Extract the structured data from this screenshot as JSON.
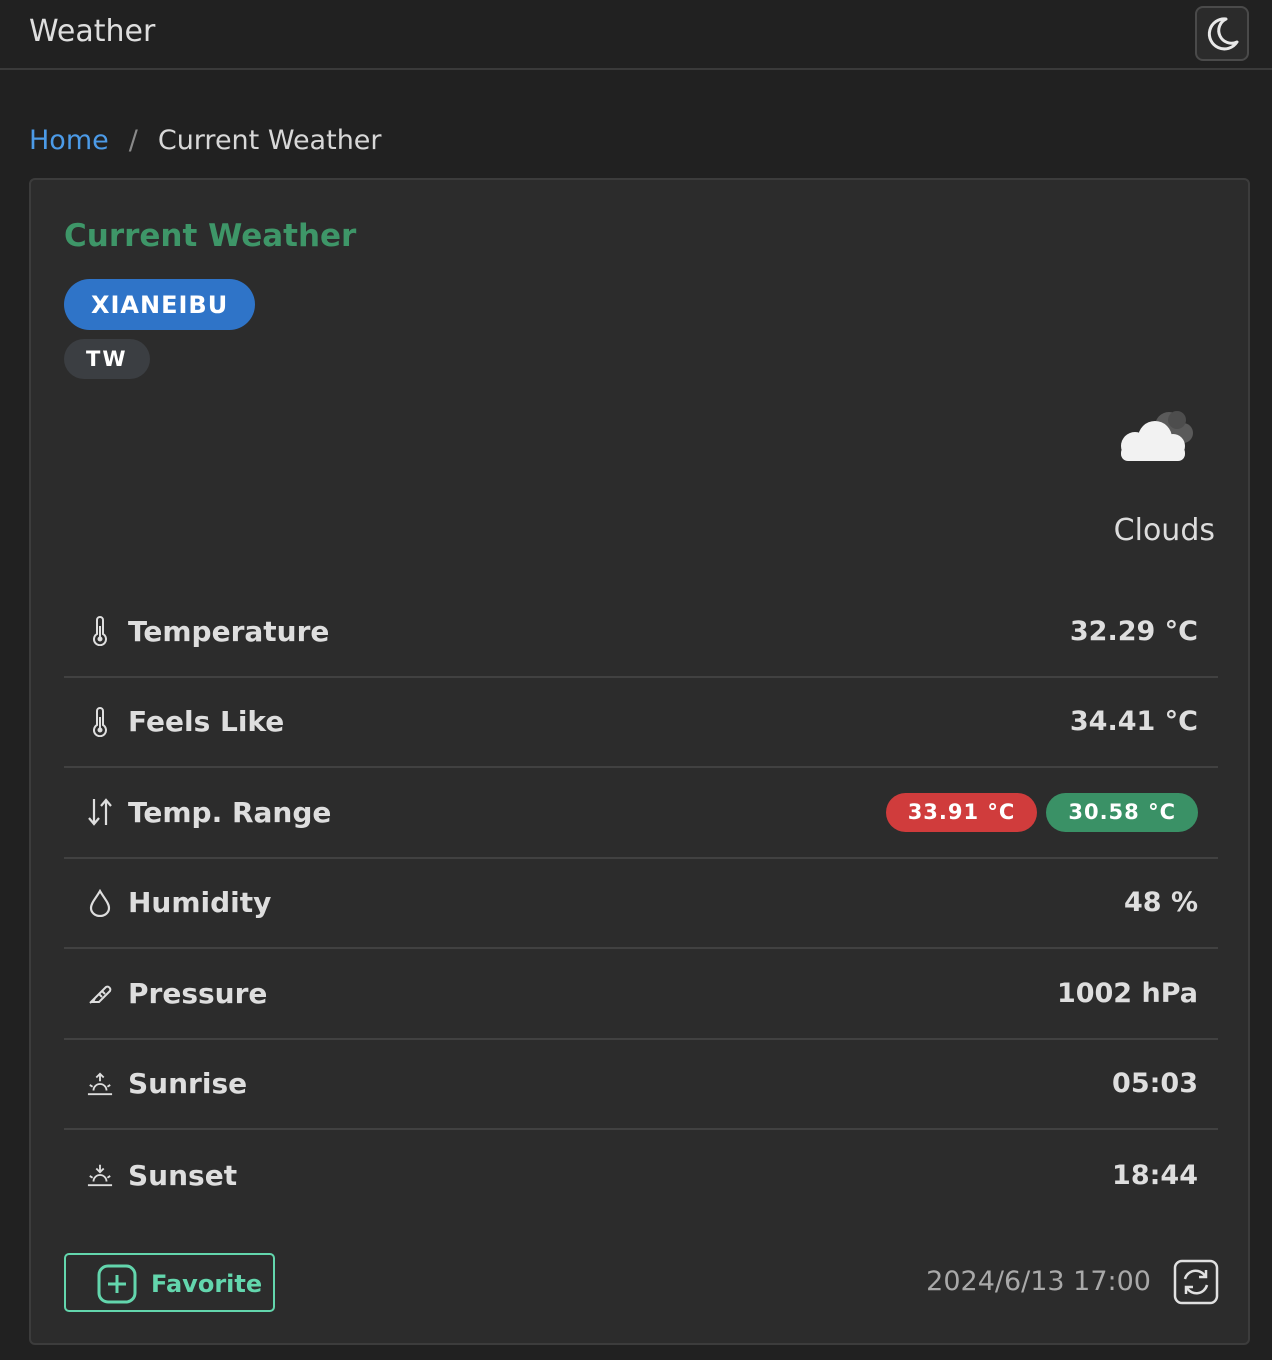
{
  "app": {
    "title": "Weather",
    "theme_toggle_icon": "moon-icon"
  },
  "breadcrumb": {
    "home": "Home",
    "separator": "/",
    "current": "Current Weather"
  },
  "card": {
    "title": "Current Weather",
    "city": "XIANEIBU",
    "country": "TW",
    "condition": "Clouds",
    "condition_icon": "clouds-icon",
    "rows": [
      {
        "icon": "thermometer-icon",
        "label": "Temperature",
        "value": "32.29 °C"
      },
      {
        "icon": "thermometer-icon",
        "label": "Feels Like",
        "value": "34.41 °C"
      },
      {
        "icon": "arrows-up-down-icon",
        "label": "Temp. Range",
        "max": "33.91 °C",
        "min": "30.58 °C"
      },
      {
        "icon": "droplet-icon",
        "label": "Humidity",
        "value": "48 %"
      },
      {
        "icon": "gauge-needle-icon",
        "label": "Pressure",
        "value": "1002 hPa"
      },
      {
        "icon": "sunrise-icon",
        "label": "Sunrise",
        "value": "05:03"
      },
      {
        "icon": "sunset-icon",
        "label": "Sunset",
        "value": "18:44"
      }
    ],
    "favorite_label": "Favorite",
    "updated_at": "2024/6/13 17:00"
  },
  "colors": {
    "accent_green": "#3e9668",
    "badge_blue": "#2f74c8",
    "max_red": "#d03c3c",
    "min_green": "#3a9166",
    "favorite_teal": "#63d6ad"
  }
}
